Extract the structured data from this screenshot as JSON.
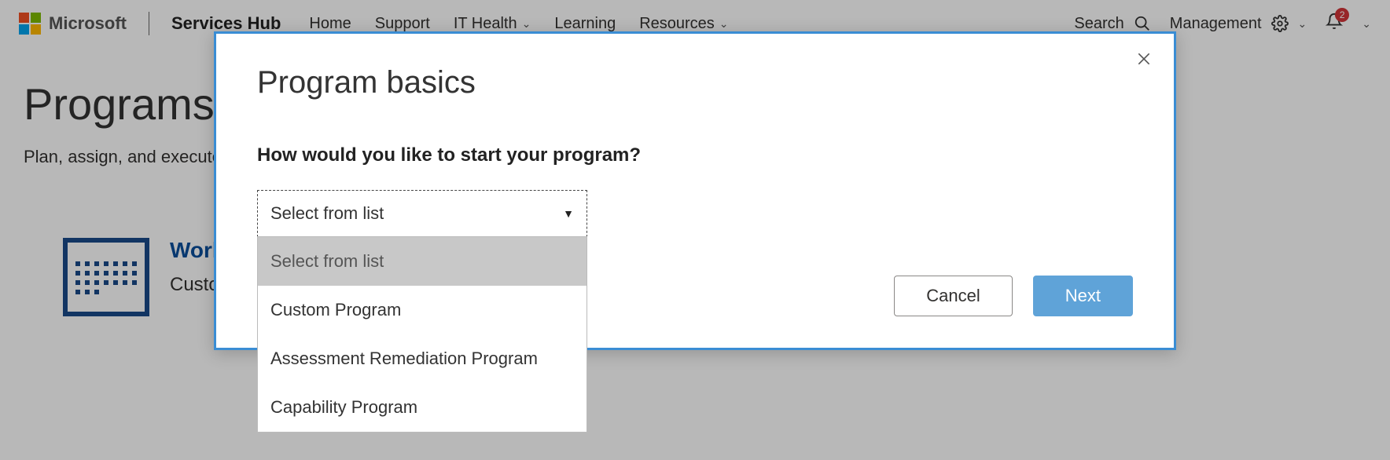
{
  "topbar": {
    "brand": "Microsoft",
    "hub": "Services Hub",
    "links": {
      "home": "Home",
      "support": "Support",
      "ithealth": "IT Health",
      "learning": "Learning",
      "resources": "Resources"
    },
    "search": "Search",
    "management": "Management",
    "notification_count": "2"
  },
  "page": {
    "title": "Programs",
    "subtitle": "Plan, assign, and execute on the steps that w",
    "card": {
      "title": "Workforce Mod                                              rt Teams",
      "subtitle": "Custom Program"
    }
  },
  "modal": {
    "title": "Program basics",
    "question": "How would you like to start your program?",
    "select_value": "Select from list",
    "options": {
      "placeholder": "Select from list",
      "opt1": "Custom Program",
      "opt2": "Assessment Remediation Program",
      "opt3": "Capability Program"
    },
    "cancel": "Cancel",
    "next": "Next"
  }
}
